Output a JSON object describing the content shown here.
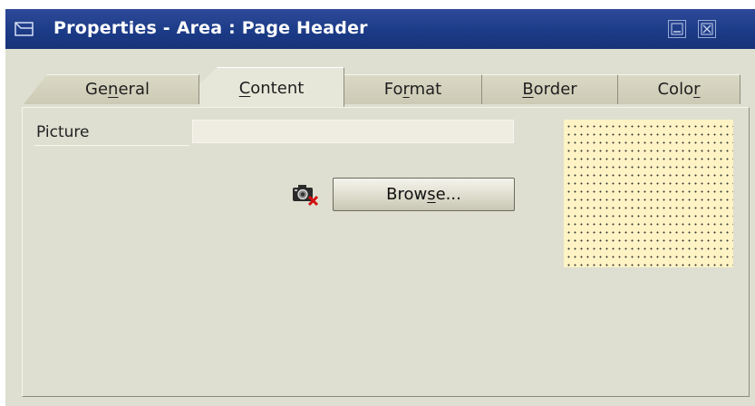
{
  "window": {
    "title": "Properties - Area : Page Header"
  },
  "tabs": [
    {
      "pre": "Ge",
      "u": "n",
      "post": "eral"
    },
    {
      "pre": "",
      "u": "C",
      "post": "ontent"
    },
    {
      "pre": "Fo",
      "u": "r",
      "post": "mat"
    },
    {
      "pre": "",
      "u": "B",
      "post": "order"
    },
    {
      "pre": "Colo",
      "u": "r",
      "post": ""
    }
  ],
  "active_tab": "Content",
  "content": {
    "picture_label": "Picture",
    "picture_value": "",
    "browse": {
      "pre": "Brow",
      "u": "s",
      "post": "e..."
    }
  },
  "colors": {
    "titlebar": "#1b3a86",
    "window_bg": "#dedfd1",
    "preview_bg": "#fef3c4"
  },
  "icons": [
    "window-icon",
    "minimize-icon",
    "close-icon",
    "camera-delete-icon"
  ]
}
